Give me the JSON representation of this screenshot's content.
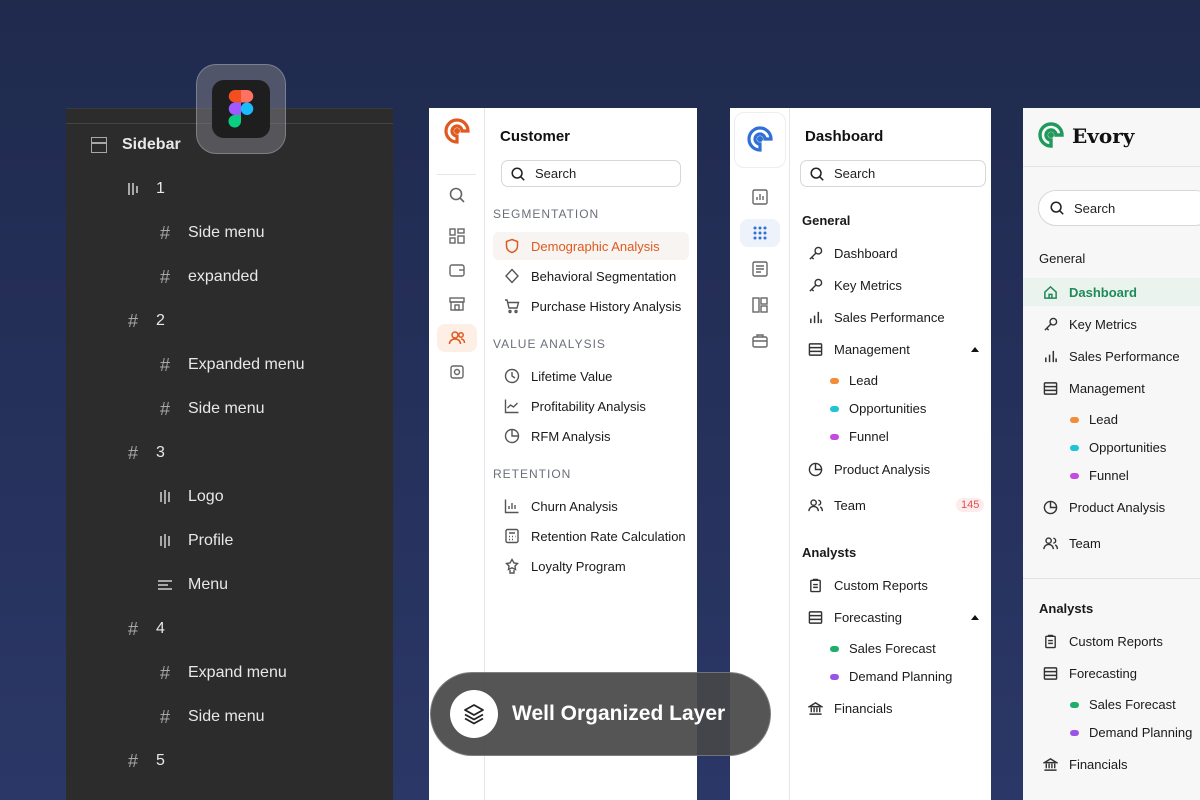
{
  "layers": {
    "root": {
      "label": "Sidebar",
      "icon": "frame-icon"
    },
    "rows": [
      {
        "label": "1",
        "icon": "auto-layout-icon"
      },
      {
        "label": "Side menu",
        "icon": "hash-icon"
      },
      {
        "label": "expanded",
        "icon": "hash-icon"
      },
      {
        "label": "2",
        "icon": "hash-icon"
      },
      {
        "label": "Expanded menu",
        "icon": "hash-icon"
      },
      {
        "label": "Side menu",
        "icon": "hash-icon"
      },
      {
        "label": "3",
        "icon": "hash-icon"
      },
      {
        "label": "Logo",
        "icon": "auto-layout-icon"
      },
      {
        "label": "Profile",
        "icon": "auto-layout-icon"
      },
      {
        "label": "Menu",
        "icon": "text-align-icon"
      },
      {
        "label": "4",
        "icon": "hash-icon"
      },
      {
        "label": "Expand menu",
        "icon": "hash-icon"
      },
      {
        "label": "Side menu",
        "icon": "hash-icon"
      },
      {
        "label": "5",
        "icon": "hash-icon"
      }
    ]
  },
  "customer": {
    "title": "Customer",
    "search_placeholder": "Search",
    "sections": [
      {
        "heading": "SEGMENTATION",
        "items": [
          "Demographic Analysis",
          "Behavioral Segmentation",
          "Purchase History Analysis"
        ]
      },
      {
        "heading": "VALUE ANALYSIS",
        "items": [
          "Lifetime Value",
          "Profitability Analysis",
          "RFM Analysis"
        ]
      },
      {
        "heading": "RETENTION",
        "items": [
          "Churn Analysis",
          "Retention Rate Calculation",
          "Loyalty Program"
        ]
      }
    ],
    "accent": "#e0591f"
  },
  "dashboard": {
    "title": "Dashboard",
    "search_placeholder": "Search",
    "general_heading": "General",
    "general_items": [
      "Dashboard",
      "Key Metrics",
      "Sales Performance",
      "Management"
    ],
    "management_sub": [
      "Lead",
      "Opportunities",
      "Funnel"
    ],
    "more_items": [
      "Product Analysis",
      "Team"
    ],
    "team_badge": "145",
    "analysts_heading": "Analysts",
    "analysts_items": [
      "Custom Reports",
      "Forecasting"
    ],
    "forecast_sub": [
      "Sales Forecast",
      "Demand Planning"
    ],
    "last_item": "Financials",
    "accent": "#2f6fd6"
  },
  "evory": {
    "brand": "Evory",
    "search_placeholder": "Search",
    "general_heading": "General",
    "general_items": [
      "Dashboard",
      "Key Metrics",
      "Sales Performance",
      "Management"
    ],
    "management_sub": [
      "Lead",
      "Opportunities",
      "Funnel"
    ],
    "more_items": [
      "Product Analysis",
      "Team"
    ],
    "analysts_heading": "Analysts",
    "analysts_items": [
      "Custom Reports",
      "Forecasting"
    ],
    "forecast_sub": [
      "Sales Forecast",
      "Demand Planning"
    ],
    "last_item": "Financials",
    "accent": "#1f8a57"
  },
  "dot_colors": {
    "lead": "#f28c38",
    "opportunities": "#22c3d6",
    "funnel": "#c74ae0",
    "sales_forecast": "#1fae6a",
    "demand_planning": "#9b55e6"
  },
  "pill": {
    "label": "Well Organized Layer",
    "icon": "layers-icon"
  }
}
